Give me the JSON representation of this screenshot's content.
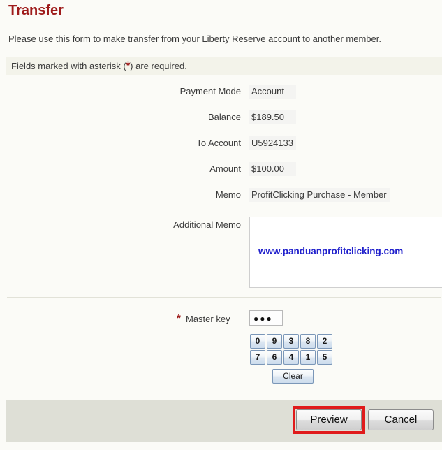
{
  "page": {
    "title": "Transfer",
    "intro": "Please use this form to make transfer from your Liberty Reserve account to another member.",
    "notice_prefix": "Fields marked with asterisk (",
    "notice_star": "*",
    "notice_suffix": ") are required.",
    "accent_red": "#9e1b1b",
    "highlight_red": "#e01b1b",
    "link_blue": "#2020cc",
    "notice_bg": "#f3f3ea",
    "footer_bg": "#dedfd6",
    "page_bg": "#fbfbf7"
  },
  "form": {
    "rows": [
      {
        "label": "Payment Mode",
        "value": "Account"
      },
      {
        "label": "Balance",
        "value": "$189.50"
      },
      {
        "label": "To Account",
        "value": "U5924133"
      },
      {
        "label": "Amount",
        "value": "$100.00"
      },
      {
        "label": "Memo",
        "value": "ProfitClicking Purchase - Member"
      }
    ],
    "additional_memo": {
      "label": "Additional Memo",
      "value": "www.panduanprofitclicking.com"
    },
    "master_key": {
      "required_star": "*",
      "label": "Master key",
      "masked_value": "●●●",
      "length": 3
    },
    "keypad": {
      "rows": [
        [
          "0",
          "9",
          "3",
          "8",
          "2"
        ],
        [
          "7",
          "6",
          "4",
          "1",
          "5"
        ]
      ],
      "clear_label": "Clear"
    }
  },
  "footer": {
    "preview_label": "Preview",
    "cancel_label": "Cancel"
  }
}
